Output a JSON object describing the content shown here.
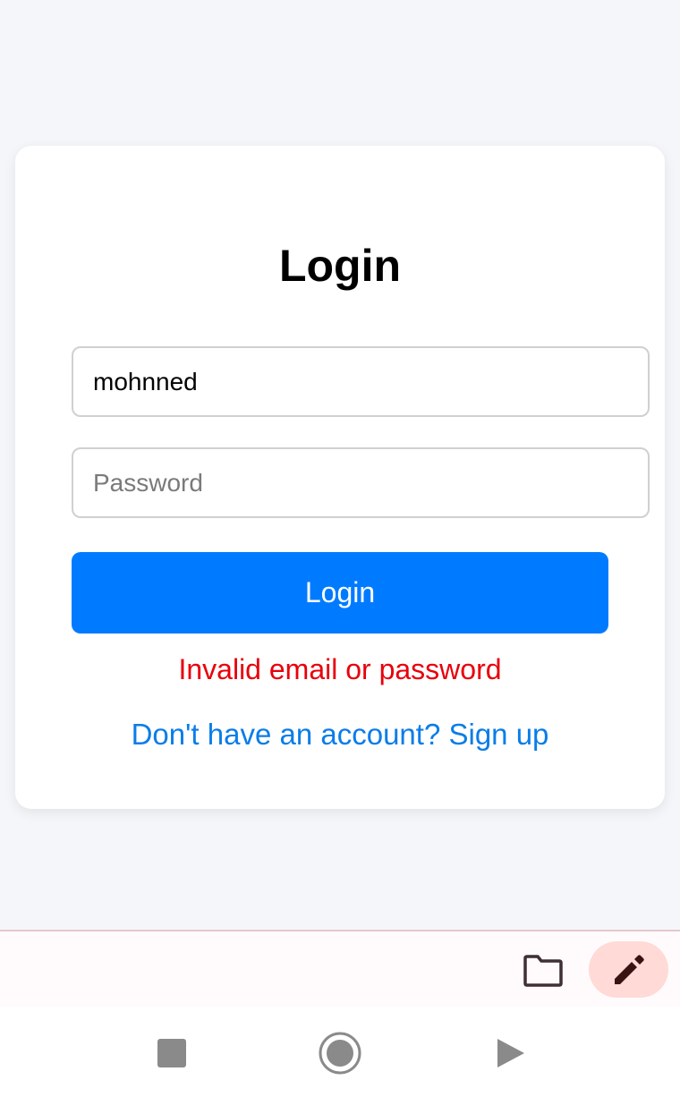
{
  "login": {
    "title": "Login",
    "email_value": "mohnned",
    "password_placeholder": "Password",
    "button_label": "Login",
    "error_message": "Invalid email or password",
    "signup_link": "Don't have an account? Sign up"
  },
  "toolbar": {
    "icons": [
      "folder-icon",
      "pencil-icon"
    ]
  },
  "navbar": {
    "icons": [
      "square-icon",
      "circle-icon",
      "triangle-icon"
    ]
  },
  "colors": {
    "page_background": "#f5f6fa",
    "primary_button": "#007bff",
    "error_text": "#e8000b",
    "link_text": "#0a7de8",
    "edit_button_bg": "#ffdad6"
  }
}
